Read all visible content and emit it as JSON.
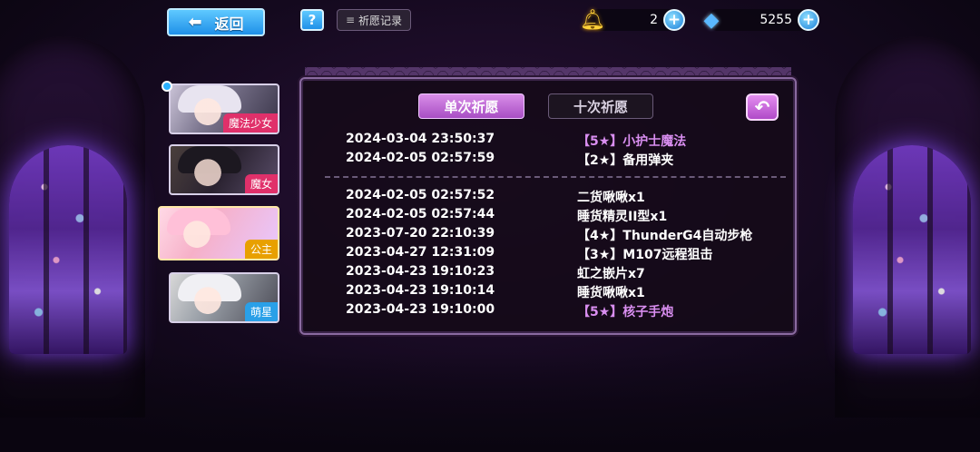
{
  "header": {
    "back_label": "返回",
    "help_label": "?",
    "record_label": "祈愿记录"
  },
  "currency": {
    "bell_amount": "2",
    "gem_amount": "5255",
    "bell_icon": "bell-icon",
    "gem_icon": "gem-icon",
    "plus_label": "+"
  },
  "characters": [
    {
      "label": "魔法少女"
    },
    {
      "label": "魔女"
    },
    {
      "label": "公主"
    },
    {
      "label": "萌星"
    }
  ],
  "tabs": {
    "single": "单次祈愿",
    "ten": "十次祈愿",
    "active": "single"
  },
  "records": {
    "top": [
      {
        "time": "2024-03-04 23:50:37",
        "item": "【5★】小护士魔法",
        "rarity": 5
      },
      {
        "time": "2024-02-05 02:57:59",
        "item": "【2★】备用弹夹",
        "rarity": 2
      }
    ],
    "bottom": [
      {
        "time": "2024-02-05 02:57:52",
        "item": "二货啾啾x1",
        "rarity": 0
      },
      {
        "time": "2024-02-05 02:57:44",
        "item": "睡货精灵II型x1",
        "rarity": 0
      },
      {
        "time": "2023-07-20 22:10:39",
        "item": "【4★】ThunderG4自动步枪",
        "rarity": 4
      },
      {
        "time": "2023-04-27 12:31:09",
        "item": "【3★】M107远程狙击",
        "rarity": 3
      },
      {
        "time": "2023-04-23 19:10:23",
        "item": "虹之嵌片x7",
        "rarity": 0
      },
      {
        "time": "2023-04-23 19:10:14",
        "item": "睡货啾啾x1",
        "rarity": 0
      },
      {
        "time": "2023-04-23 19:10:00",
        "item": "【5★】核子手炮",
        "rarity": 5
      }
    ]
  },
  "colors": {
    "rare_text": "#d98ef0",
    "accent_blue": "#1f90e8",
    "tab_active": "#a84ec4"
  }
}
